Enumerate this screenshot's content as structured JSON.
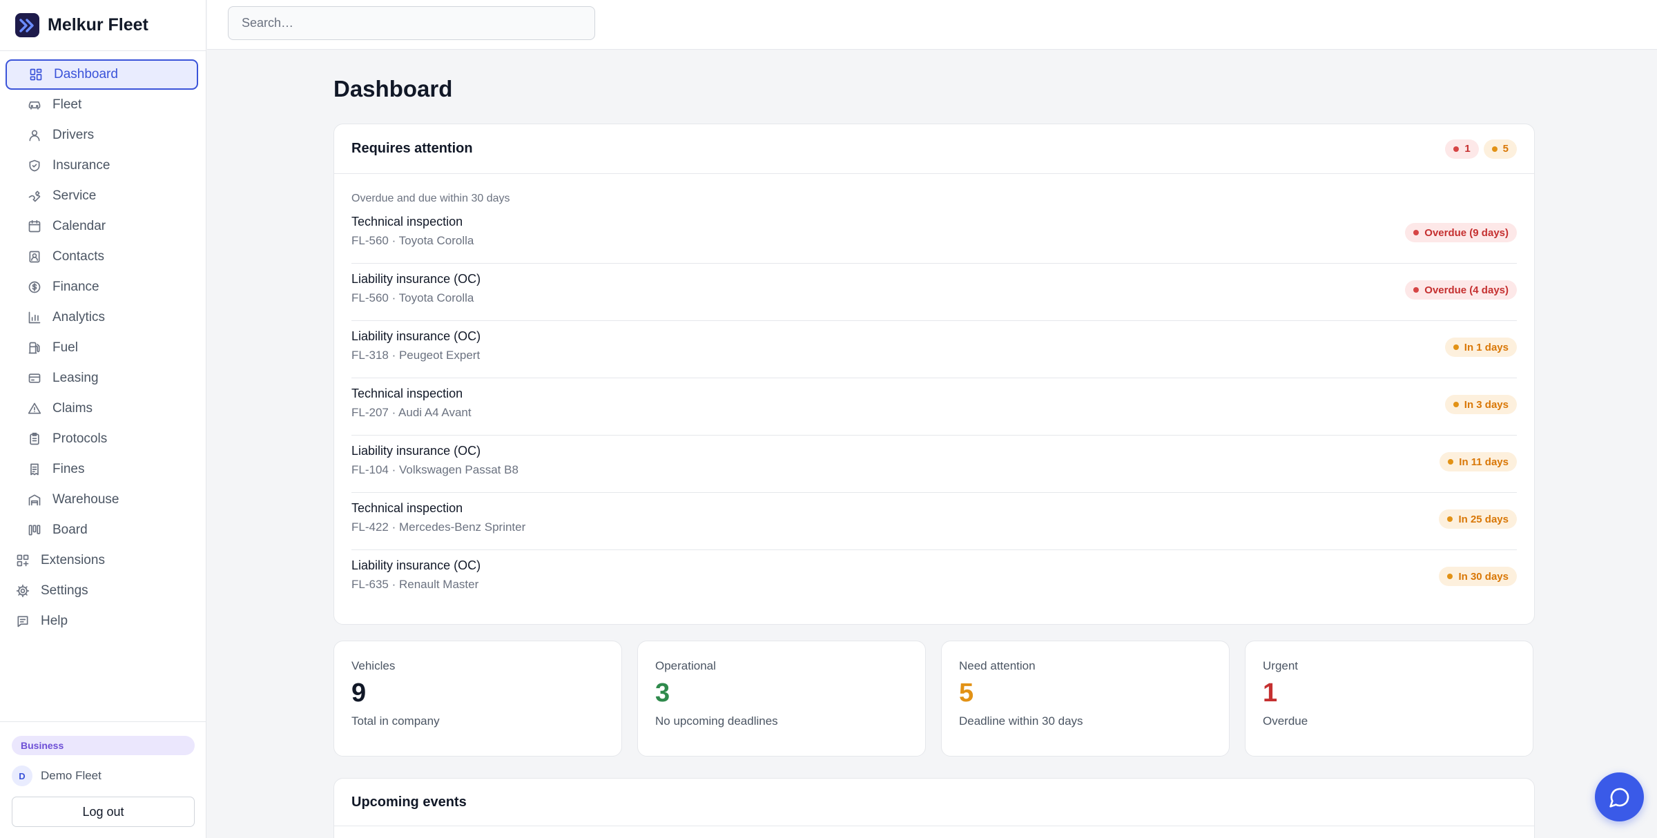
{
  "app": {
    "name": "Melkur Fleet"
  },
  "search": {
    "placeholder": "Search…"
  },
  "sidebar": {
    "items": [
      {
        "label": "Dashboard",
        "icon": "dashboard-icon",
        "active": true,
        "level": "sub"
      },
      {
        "label": "Fleet",
        "icon": "car-icon",
        "level": "sub"
      },
      {
        "label": "Drivers",
        "icon": "user-icon",
        "level": "sub"
      },
      {
        "label": "Insurance",
        "icon": "shield-icon",
        "level": "sub"
      },
      {
        "label": "Service",
        "icon": "wrench-icon",
        "level": "sub"
      },
      {
        "label": "Calendar",
        "icon": "calendar-icon",
        "level": "sub"
      },
      {
        "label": "Contacts",
        "icon": "contact-icon",
        "level": "sub"
      },
      {
        "label": "Finance",
        "icon": "dollar-icon",
        "level": "sub"
      },
      {
        "label": "Analytics",
        "icon": "bar-chart-icon",
        "level": "sub"
      },
      {
        "label": "Fuel",
        "icon": "fuel-icon",
        "level": "sub"
      },
      {
        "label": "Leasing",
        "icon": "card-icon",
        "level": "sub"
      },
      {
        "label": "Claims",
        "icon": "warning-icon",
        "level": "sub"
      },
      {
        "label": "Protocols",
        "icon": "clipboard-icon",
        "level": "sub"
      },
      {
        "label": "Fines",
        "icon": "receipt-icon",
        "level": "sub"
      },
      {
        "label": "Warehouse",
        "icon": "warehouse-icon",
        "level": "sub"
      },
      {
        "label": "Board",
        "icon": "kanban-icon",
        "level": "sub"
      },
      {
        "label": "Extensions",
        "icon": "extensions-icon",
        "level": "top"
      },
      {
        "label": "Settings",
        "icon": "gear-icon",
        "level": "top"
      },
      {
        "label": "Help",
        "icon": "help-icon",
        "level": "top"
      }
    ],
    "plan": "Business",
    "user": {
      "initial": "D",
      "name": "Demo Fleet"
    },
    "logout_label": "Log out"
  },
  "main": {
    "title": "Dashboard",
    "attention": {
      "title": "Requires attention",
      "counts": {
        "overdue": "1",
        "upcoming": "5"
      },
      "subtitle": "Overdue and due within 30 days",
      "items": [
        {
          "title": "Technical inspection",
          "vehicle": "FL-560 · Toyota Corolla",
          "status": "Overdue (9 days)",
          "level": "red"
        },
        {
          "title": "Liability insurance (OC)",
          "vehicle": "FL-560 · Toyota Corolla",
          "status": "Overdue (4 days)",
          "level": "red"
        },
        {
          "title": "Liability insurance (OC)",
          "vehicle": "FL-318 · Peugeot Expert",
          "status": "In 1 days",
          "level": "amber"
        },
        {
          "title": "Technical inspection",
          "vehicle": "FL-207 · Audi A4 Avant",
          "status": "In 3 days",
          "level": "amber"
        },
        {
          "title": "Liability insurance (OC)",
          "vehicle": "FL-104 · Volkswagen Passat B8",
          "status": "In 11 days",
          "level": "amber"
        },
        {
          "title": "Technical inspection",
          "vehicle": "FL-422 · Mercedes-Benz Sprinter",
          "status": "In 25 days",
          "level": "amber"
        },
        {
          "title": "Liability insurance (OC)",
          "vehicle": "FL-635 · Renault Master",
          "status": "In 30 days",
          "level": "amber"
        }
      ]
    },
    "stats": [
      {
        "label": "Vehicles",
        "value": "9",
        "desc": "Total in company",
        "color": "#111827"
      },
      {
        "label": "Operational",
        "value": "3",
        "desc": "No upcoming deadlines",
        "color": "#2f8a4c"
      },
      {
        "label": "Need attention",
        "value": "5",
        "desc": "Deadline within 30 days",
        "color": "#e29216"
      },
      {
        "label": "Urgent",
        "value": "1",
        "desc": "Overdue",
        "color": "#c53030"
      }
    ],
    "upcoming": {
      "title": "Upcoming events"
    }
  },
  "colors": {
    "accent": "#3a53d9",
    "red": "#c53030",
    "amber": "#d97706",
    "green": "#2f8a4c"
  }
}
